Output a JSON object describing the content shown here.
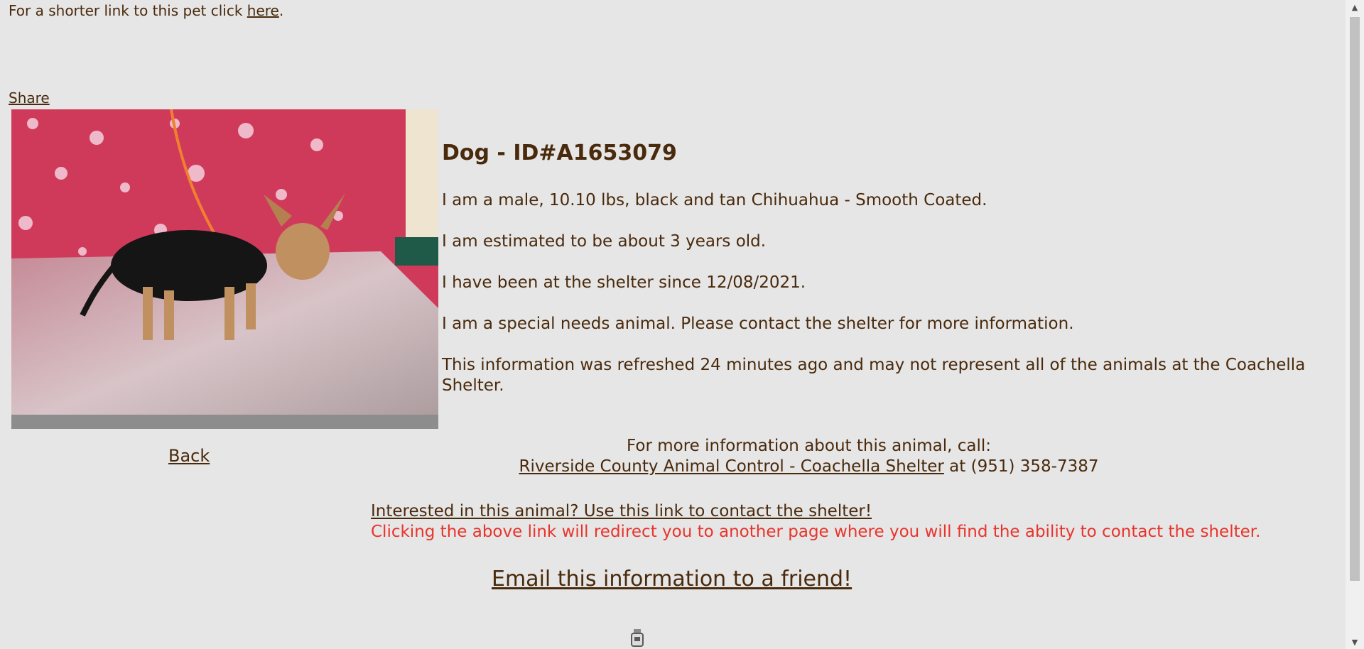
{
  "shortlink": {
    "prefix": "For a shorter link to this pet click ",
    "link": "here",
    "suffix": "."
  },
  "share_label": "Share",
  "animal": {
    "title": "Dog - ID#A1653079",
    "description": "I am a male, 10.10 lbs, black and tan Chihuahua - Smooth Coated.",
    "age": "I am estimated to be about 3 years old.",
    "since": "I have been at the shelter since 12/08/2021.",
    "special_needs": "I am a special needs animal. Please contact the shelter for more information.",
    "refresh": "This information was refreshed 24 minutes ago and may not represent all of the animals at the Coachella Shelter."
  },
  "back_label": "Back",
  "call": {
    "line1": "For more information about this animal, call:",
    "shelter_link": "Riverside County Animal Control - Coachella Shelter",
    "phone": " at (951) 358-7387"
  },
  "contact": {
    "link": "Interested in this animal? Use this link to contact the shelter!",
    "note": "Clicking the above link will redirect you to another page where you will find the ability to contact the shelter."
  },
  "email_label": "Email this information to a friend!",
  "colors": {
    "background": "#e6e6e6",
    "text": "#4a2a0c",
    "warning": "#e8342c"
  }
}
